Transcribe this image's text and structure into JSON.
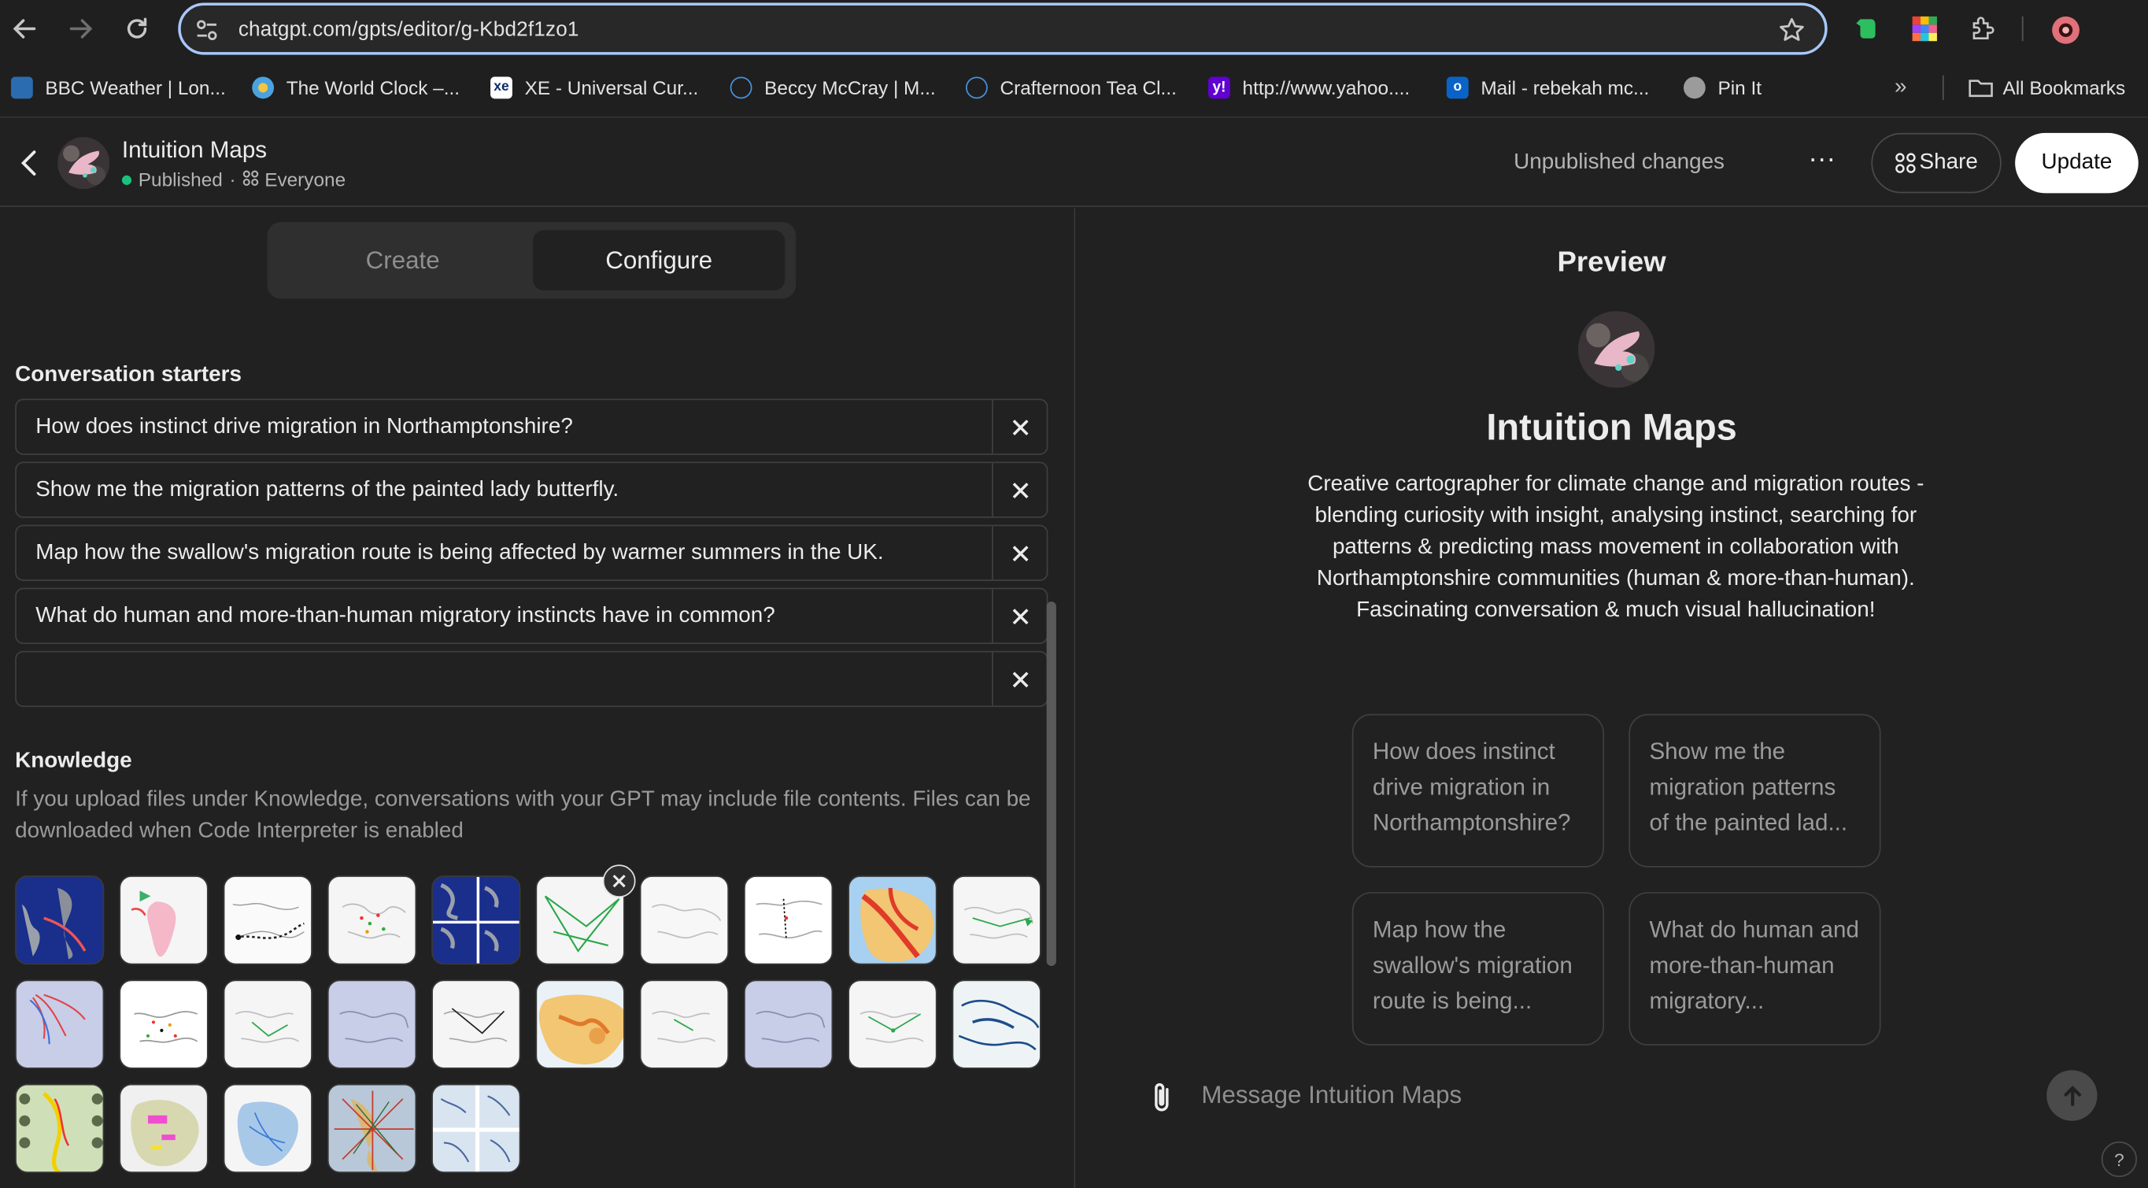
{
  "browser": {
    "url": "chatgpt.com/gpts/editor/g-Kbd2f1zo1",
    "bookmarks": [
      {
        "label": "BBC Weather | Lon...",
        "color": "#2b6cb0"
      },
      {
        "label": "The World Clock –...",
        "color": "#f5c542"
      },
      {
        "label": "XE - Universal Cur...",
        "color": "#ffffff"
      },
      {
        "label": "Beccy McCray | M...",
        "color": "#4a90d9"
      },
      {
        "label": "Crafternoon Tea Cl...",
        "color": "#4a90d9"
      },
      {
        "label": "http://www.yahoo....",
        "color": "#6001d2"
      },
      {
        "label": "Mail - rebekah mc...",
        "color": "#0a64c8"
      },
      {
        "label": "Pin It",
        "color": "#9b9b9b"
      }
    ],
    "all_bookmarks": "All Bookmarks"
  },
  "header": {
    "gpt_name": "Intuition Maps",
    "status": "Published",
    "separator": "·",
    "audience": "Everyone",
    "unpublished": "Unpublished changes",
    "more": "···",
    "share": "Share",
    "update": "Update"
  },
  "editor": {
    "tabs": {
      "create": "Create",
      "configure": "Configure"
    },
    "starters_label": "Conversation starters",
    "starters": [
      "How does instinct drive migration in Northamptonshire?",
      "Show me the migration patterns of the painted lady butterfly.",
      "Map how the swallow's migration route is being affected by warmer summers in the UK.",
      "What do human and more-than-human migratory instincts have in common?",
      ""
    ],
    "knowledge_label": "Knowledge",
    "knowledge_text": "If you upload files under Knowledge, conversations with your GPT may include file contents. Files can be downloaded when Code Interpreter is enabled"
  },
  "preview": {
    "title": "Preview",
    "name": "Intuition Maps",
    "description": "Creative cartographer for climate change and migration routes - blending curiosity with insight, analysing instinct, searching for patterns & predicting mass movement in collaboration with Northamptonshire communities (human & more-than-human). Fascinating conversation & much visual hallucination!",
    "cards": [
      "How does instinct drive migration in Northamptonshire?",
      "Show me the migration patterns of the painted lad...",
      "Map how the swallow's migration route is being...",
      "What do human and more-than-human migratory..."
    ],
    "message_placeholder": "Message Intuition Maps",
    "help": "?"
  }
}
